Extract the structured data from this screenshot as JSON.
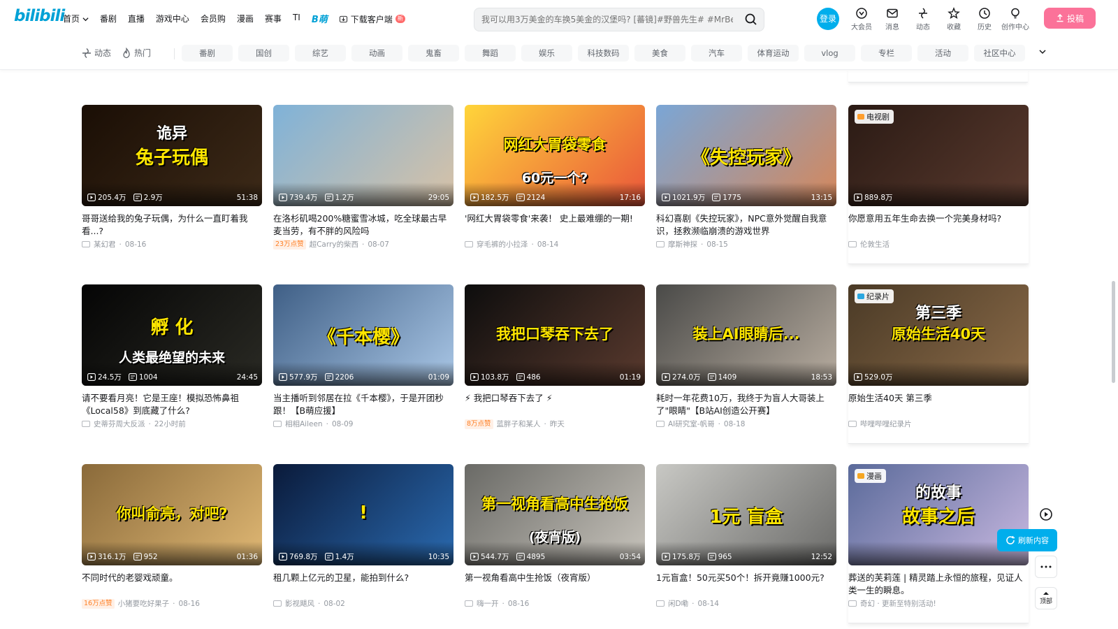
{
  "brand": {
    "logo": "bilibili",
    "accent": "#00a1d6",
    "pink": "#fb7299"
  },
  "nav": {
    "items": [
      "首页",
      "番剧",
      "直播",
      "游戏中心",
      "会员购",
      "漫画",
      "赛事",
      "TI",
      "B萌",
      "下载客户端"
    ],
    "home_chevron": "chevron-down-icon",
    "new_badge": "新"
  },
  "search": {
    "placeholder": "我可以用3万美金的车换5美金的汉堡吗? [蕃镜]#野兽先生# #MrBe",
    "icon": "search-icon"
  },
  "user": {
    "login": "登录",
    "icons": [
      {
        "label": "大会员",
        "icon": "vip-icon"
      },
      {
        "label": "消息",
        "icon": "mail-icon"
      },
      {
        "label": "动态",
        "icon": "wind-icon"
      },
      {
        "label": "收藏",
        "icon": "star-icon"
      },
      {
        "label": "历史",
        "icon": "clock-icon"
      },
      {
        "label": "创作中心",
        "icon": "bulb-icon"
      }
    ],
    "upload": "投稿"
  },
  "channels": {
    "feed": "动态",
    "hot": "热门",
    "chips": [
      "番剧",
      "国创",
      "综艺",
      "动画",
      "鬼畜",
      "舞蹈",
      "娱乐",
      "科技数码",
      "美食",
      "汽车",
      "体育运动",
      "vlog",
      "专栏",
      "活动",
      "社区中心"
    ]
  },
  "cards": [
    {
      "thumb_text": "兔子玩偶",
      "thumb_text2": "诡异",
      "views": "205.4万",
      "danmaku": "2.9万",
      "duration": "51:38",
      "title": "哥哥送给我的兔子玩偶，为什么一直盯着我看...?",
      "author": "某幻君",
      "date": "08-16",
      "tag": "",
      "bg": [
        "#1a0e05",
        "#3d2a18"
      ]
    },
    {
      "thumb_text": "",
      "thumb_text2": "",
      "views": "739.4万",
      "danmaku": "1.2万",
      "duration": "29:05",
      "title": "在洛杉矶喝200%糖蜜雪冰城，吃全球最古早麦当劳，有不胖的风险吗",
      "author": "超Carry的柴西",
      "date": "08-07",
      "tag": "23万点赞",
      "bg": [
        "#7fb2d8",
        "#d8c2a6"
      ]
    },
    {
      "thumb_text": "网红大胃袋零食",
      "thumb_text2": "60元一个?",
      "views": "182.5万",
      "danmaku": "2124",
      "duration": "17:16",
      "title": "'网红大胃袋零食'来袭！ 史上最难绷的一期!",
      "author": "穿毛裤的小拉泽",
      "date": "08-14",
      "tag": "",
      "bg": [
        "#ffd53a",
        "#e9553a"
      ]
    },
    {
      "thumb_text": "《失控玩家》",
      "thumb_text2": "",
      "views": "1021.9万",
      "danmaku": "1775",
      "duration": "13:15",
      "title": "科幻喜剧《失控玩家》，NPC意外觉醒自我意识，拯救濒临崩溃的游戏世界",
      "author": "摩斯神探",
      "date": "08-15",
      "tag": "",
      "bg": [
        "#7aa6d6",
        "#d6875a"
      ]
    },
    {
      "badge": "电视剧",
      "badge_color": "#ff9e2c",
      "thumb_text": "",
      "thumb_text2": "",
      "views": "889.8万",
      "danmaku": "",
      "duration": "",
      "title": "你愿意用五年生命去换一个完美身材吗?",
      "author": "伦敦生活",
      "date": "",
      "tag": "",
      "bg": [
        "#2a1a14",
        "#5a3a2e"
      ]
    },
    {
      "thumb_text": "孵  化",
      "thumb_text2": "人类最绝望的未来",
      "views": "24.5万",
      "danmaku": "1004",
      "duration": "24:45",
      "title": "请不要看月亮！它是王座！模拟恐怖鼻祖《Local58》到底藏了什么?",
      "author": "史蒂芬周大反派",
      "date": "22小时前",
      "tag": "",
      "bg": [
        "#050505",
        "#2a2a24"
      ]
    },
    {
      "thumb_text": "《千本樱》",
      "thumb_text2": "",
      "views": "577.9万",
      "danmaku": "2206",
      "duration": "01:09",
      "title": "当主播听到邻居在拉《千本樱》，于是开团秒跟！【B萌应援】",
      "author": "相相Aileen",
      "date": "08-09",
      "tag": "",
      "bg": [
        "#3f5f86",
        "#aac7e6"
      ]
    },
    {
      "thumb_text": "我把口琴吞下去了",
      "thumb_text2": "",
      "views": "103.8万",
      "danmaku": "486",
      "duration": "01:19",
      "title": "⚡ 我把口琴吞下去了 ⚡",
      "author": "蓝胖子和某人",
      "date": "昨天",
      "tag": "8万点赞",
      "bg": [
        "#0d0d0d",
        "#5a3a2e"
      ]
    },
    {
      "thumb_text": "装上AI眼睛后...",
      "thumb_text2": "",
      "views": "274.0万",
      "danmaku": "1409",
      "duration": "18:53",
      "title": "耗时一年花费10万，我终于为盲人大哥装上了\"眼睛\"【B站AI创造公开赛】",
      "author": "AI研究室-帆哥",
      "date": "08-18",
      "tag": "",
      "bg": [
        "#4a4a48",
        "#b8ada0"
      ]
    },
    {
      "badge": "纪录片",
      "badge_color": "#2aa7e0",
      "thumb_text": "原始生活40天",
      "thumb_text2": "第三季",
      "views": "529.0万",
      "danmaku": "",
      "duration": "",
      "title": "原始生活40天 第三季",
      "author": "哔哩哔哩纪录片",
      "date": "",
      "tag": "",
      "bg": [
        "#4a3a26",
        "#8a6a48"
      ]
    },
    {
      "thumb_text": "你叫俞亮，对吧?",
      "thumb_text2": "",
      "views": "316.1万",
      "danmaku": "952",
      "duration": "01:36",
      "title": "不同时代的老婴戏顽童。",
      "author": "小猪要吃好果子",
      "date": "08-16",
      "tag": "16万点赞",
      "bg": [
        "#8a6a3a",
        "#e0b874"
      ]
    },
    {
      "thumb_text": "!",
      "thumb_text2": "",
      "views": "769.8万",
      "danmaku": "1.4万",
      "duration": "10:35",
      "title": "租几颗上亿元的卫星，能拍到什么?",
      "author": "影视飓风",
      "date": "08-02",
      "tag": "",
      "bg": [
        "#0a1a3a",
        "#2a6ab0"
      ]
    },
    {
      "thumb_text": "第一视角看高中生抢饭",
      "thumb_text2": "(夜宵版)",
      "views": "544.7万",
      "danmaku": "4895",
      "duration": "03:54",
      "title": "第一视角看高中生抢饭（夜宵版）",
      "author": "嗨一开",
      "date": "08-16",
      "tag": "",
      "bg": [
        "#6a6a66",
        "#c8c4bc"
      ]
    },
    {
      "thumb_text": "1元  盲盒",
      "thumb_text2": "",
      "views": "175.8万",
      "danmaku": "965",
      "duration": "12:52",
      "title": "1元盲盒！50元买50个！拆开竟赚1000元?",
      "author": "闲D嘞",
      "date": "08-14",
      "tag": "",
      "bg": [
        "#c8c8c4",
        "#6a6a68"
      ]
    },
    {
      "badge": "漫画",
      "badge_color": "#f5a623",
      "thumb_text": "故事之后",
      "thumb_text2": "的故事",
      "views": "",
      "danmaku": "",
      "duration": "",
      "title": "葬送的芙莉莲 | 精灵踏上永恒的旅程，见证人类一生的瞬息。",
      "author": "奇幻 · 更新至特别活动!",
      "date": "",
      "tag": "",
      "bg": [
        "#5a6a9a",
        "#c8b8e0"
      ]
    }
  ],
  "floating": {
    "refresh": "刷新内容",
    "top": "顶部"
  }
}
